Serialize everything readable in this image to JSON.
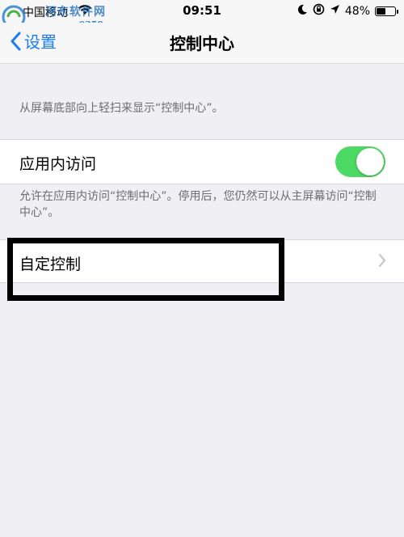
{
  "status_bar": {
    "carrier": "中国移动",
    "time": "09:51",
    "battery": "48%",
    "battery_level": 0.48
  },
  "watermark": {
    "title": "河东软件网",
    "url": "www.pc0359.cn"
  },
  "nav": {
    "back_label": "设置",
    "title": "控制中心"
  },
  "main": {
    "intro_text": "从屏幕底部向上轻扫来显示“控制中心”。",
    "in_app_access": {
      "label": "应用内访问",
      "enabled": true
    },
    "in_app_desc": "允许在应用内访问“控制中心”。停用后，您仍然可以从主屏幕访问“控制中心”。",
    "customize": {
      "label": "自定控制"
    }
  },
  "colors": {
    "accent": "#1b7cf5",
    "toggle_on": "#4cd964",
    "background": "#efeff4"
  }
}
